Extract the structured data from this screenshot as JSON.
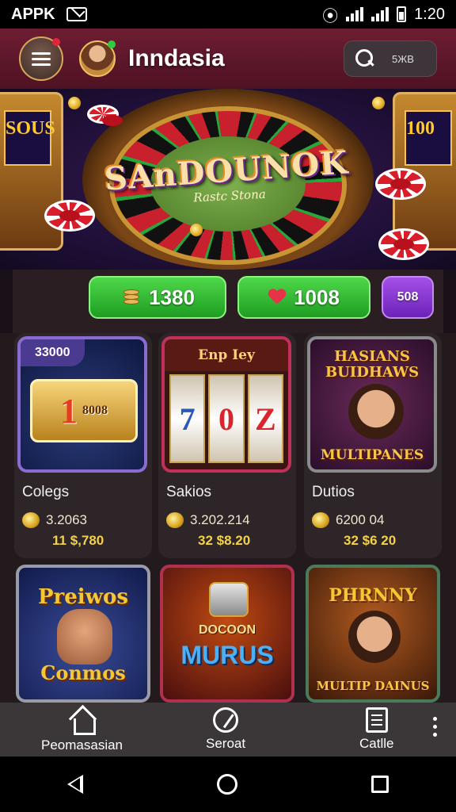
{
  "status_bar": {
    "app_label": "APPK",
    "time": "1:20"
  },
  "header": {
    "title": "Inndasia",
    "search_hint": "5ЖВ"
  },
  "hero": {
    "title": "SAnDOUNOK",
    "subtitle": "Rastc Stona"
  },
  "balances": [
    {
      "value": "1380"
    },
    {
      "value": "1008"
    },
    {
      "value": "508"
    }
  ],
  "games_row1": [
    {
      "tag": "33000",
      "art_text": "1",
      "art_small": "8008",
      "name": "Colegs",
      "stat1": "3.2063",
      "stat2": "11 $,780"
    },
    {
      "tag": "Enp Iey",
      "reels": [
        "7",
        "0",
        "Z"
      ],
      "name": "Sakios",
      "stat1": "3.202.214",
      "stat2": "32 $8.20"
    },
    {
      "poster_title": "HASIANS BUIDHAWS",
      "poster_foot": "MULTIPANES",
      "name": "Dutios",
      "stat1": "6200 04",
      "stat2": "32 $6 20"
    }
  ],
  "games_row2": [
    {
      "title_top": "Preiwos",
      "title_bottom": "Conmos"
    },
    {
      "title_top": "DOCOON",
      "title_bottom": "MURUS"
    },
    {
      "title_top": "PHRNNY",
      "title_bottom": "MULTIP DAINUS"
    }
  ],
  "bottom_nav": {
    "items": [
      {
        "label": "Peomasasian",
        "icon": "home-icon"
      },
      {
        "label": "Seroat",
        "icon": "chip-icon"
      },
      {
        "label": "Catlle",
        "icon": "doc-icon"
      }
    ]
  }
}
